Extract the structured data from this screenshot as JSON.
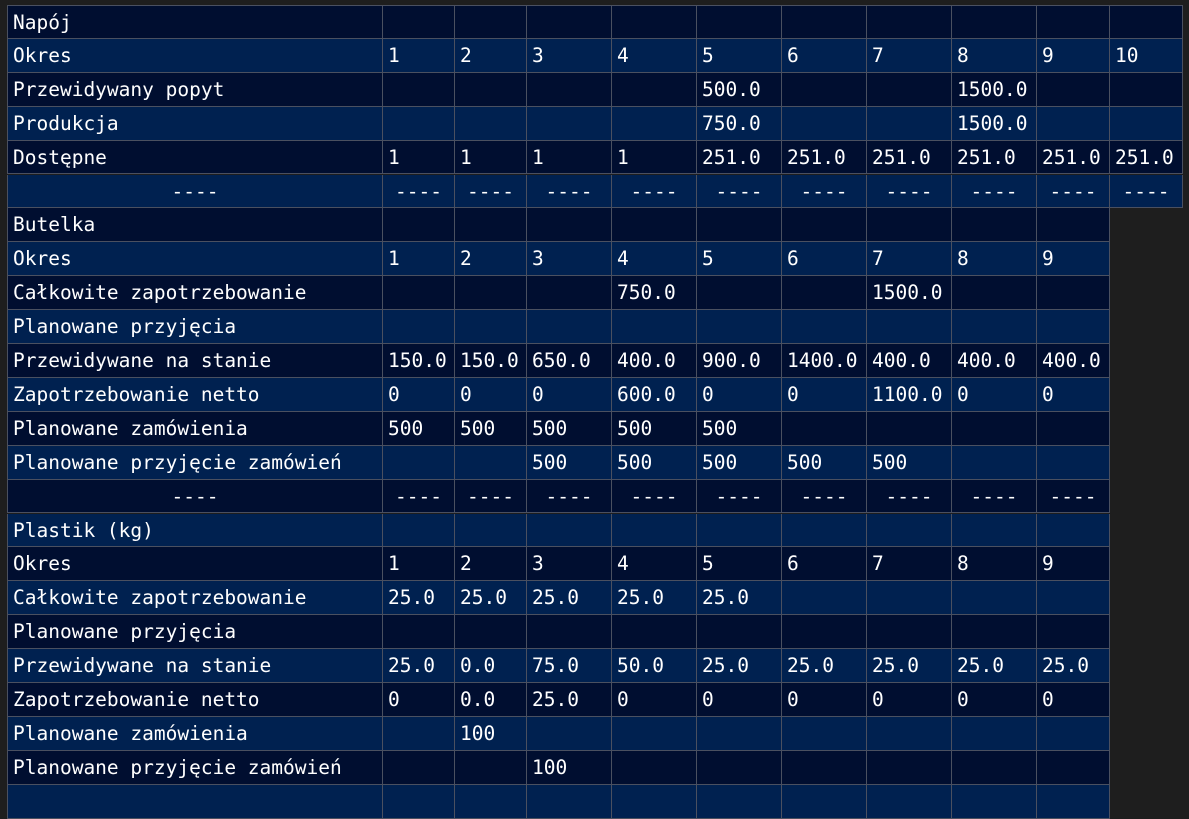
{
  "sections": [
    {
      "cols": 11,
      "rows": [
        {
          "kind": "title",
          "cells": [
            "Napój",
            "",
            "",
            "",
            "",
            "",
            "",
            "",
            "",
            "",
            ""
          ]
        },
        {
          "kind": "data",
          "cells": [
            "Okres",
            "1",
            "2",
            "3",
            "4",
            "5",
            "6",
            "7",
            "8",
            "9",
            "10"
          ]
        },
        {
          "kind": "data",
          "cells": [
            "Przewidywany popyt",
            "",
            "",
            "",
            "",
            "500.0",
            "",
            "",
            "1500.0",
            "",
            ""
          ]
        },
        {
          "kind": "data",
          "cells": [
            "Produkcja",
            "",
            "",
            "",
            "",
            "750.0",
            "",
            "",
            "1500.0",
            "",
            ""
          ]
        },
        {
          "kind": "data",
          "cells": [
            "Dostępne",
            "1",
            "1",
            "1",
            "1",
            "251.0",
            "251.0",
            "251.0",
            "251.0",
            "251.0",
            "251.0"
          ]
        },
        {
          "kind": "sep",
          "cells": [
            "----",
            "----",
            "----",
            "----",
            "----",
            "----",
            "----",
            "----",
            "----",
            "----",
            "----"
          ]
        }
      ]
    },
    {
      "cols": 10,
      "rows": [
        {
          "kind": "title",
          "cells": [
            "Butelka",
            "",
            "",
            "",
            "",
            "",
            "",
            "",
            "",
            ""
          ]
        },
        {
          "kind": "data",
          "cells": [
            "Okres",
            "1",
            "2",
            "3",
            "4",
            "5",
            "6",
            "7",
            "8",
            "9"
          ]
        },
        {
          "kind": "data",
          "cells": [
            "Całkowite zapotrzebowanie",
            "",
            "",
            "",
            "750.0",
            "",
            "",
            "1500.0",
            "",
            ""
          ]
        },
        {
          "kind": "data",
          "cells": [
            "Planowane przyjęcia",
            "",
            "",
            "",
            "",
            "",
            "",
            "",
            "",
            ""
          ]
        },
        {
          "kind": "data",
          "cells": [
            "Przewidywane na stanie",
            "150.0",
            "150.0",
            "650.0",
            "400.0",
            "900.0",
            "1400.0",
            "400.0",
            "400.0",
            "400.0"
          ]
        },
        {
          "kind": "data",
          "cells": [
            "Zapotrzebowanie netto",
            "0",
            "0",
            "0",
            "600.0",
            "0",
            "0",
            "1100.0",
            "0",
            "0"
          ]
        },
        {
          "kind": "data",
          "cells": [
            "Planowane zamówienia",
            "500",
            "500",
            "500",
            "500",
            "500",
            "",
            "",
            "",
            ""
          ]
        },
        {
          "kind": "data",
          "cells": [
            "Planowane przyjęcie zamówień",
            "",
            "",
            "500",
            "500",
            "500",
            "500",
            "500",
            "",
            ""
          ]
        },
        {
          "kind": "sep",
          "cells": [
            "----",
            "----",
            "----",
            "----",
            "----",
            "----",
            "----",
            "----",
            "----",
            "----"
          ]
        }
      ]
    },
    {
      "cols": 10,
      "rows": [
        {
          "kind": "title",
          "cells": [
            "Plastik (kg)",
            "",
            "",
            "",
            "",
            "",
            "",
            "",
            "",
            ""
          ]
        },
        {
          "kind": "data",
          "cells": [
            "Okres",
            "1",
            "2",
            "3",
            "4",
            "5",
            "6",
            "7",
            "8",
            "9"
          ]
        },
        {
          "kind": "data",
          "cells": [
            "Całkowite zapotrzebowanie",
            "25.0",
            "25.0",
            "25.0",
            "25.0",
            "25.0",
            "",
            "",
            "",
            ""
          ]
        },
        {
          "kind": "data",
          "cells": [
            "Planowane przyjęcia",
            "",
            "",
            "",
            "",
            "",
            "",
            "",
            "",
            ""
          ]
        },
        {
          "kind": "data",
          "cells": [
            "Przewidywane na stanie",
            "25.0",
            "0.0",
            "75.0",
            "50.0",
            "25.0",
            "25.0",
            "25.0",
            "25.0",
            "25.0"
          ]
        },
        {
          "kind": "data",
          "cells": [
            "Zapotrzebowanie netto",
            "0",
            "0.0",
            "25.0",
            "0",
            "0",
            "0",
            "0",
            "0",
            "0"
          ]
        },
        {
          "kind": "data",
          "cells": [
            "Planowane zamówienia",
            "",
            "100",
            "",
            "",
            "",
            "",
            "",
            "",
            ""
          ]
        },
        {
          "kind": "data",
          "cells": [
            "Planowane przyjęcie zamówień",
            "",
            "",
            "100",
            "",
            "",
            "",
            "",
            "",
            ""
          ]
        },
        {
          "kind": "data",
          "cells": [
            "",
            "",
            "",
            "",
            "",
            "",
            "",
            "",
            "",
            ""
          ]
        }
      ]
    }
  ],
  "colors": {
    "row_dark": "#000e30",
    "row_light": "#002150",
    "grid_line": "#4a5060",
    "background": "#1e1e1e",
    "text": "#ffffff"
  }
}
